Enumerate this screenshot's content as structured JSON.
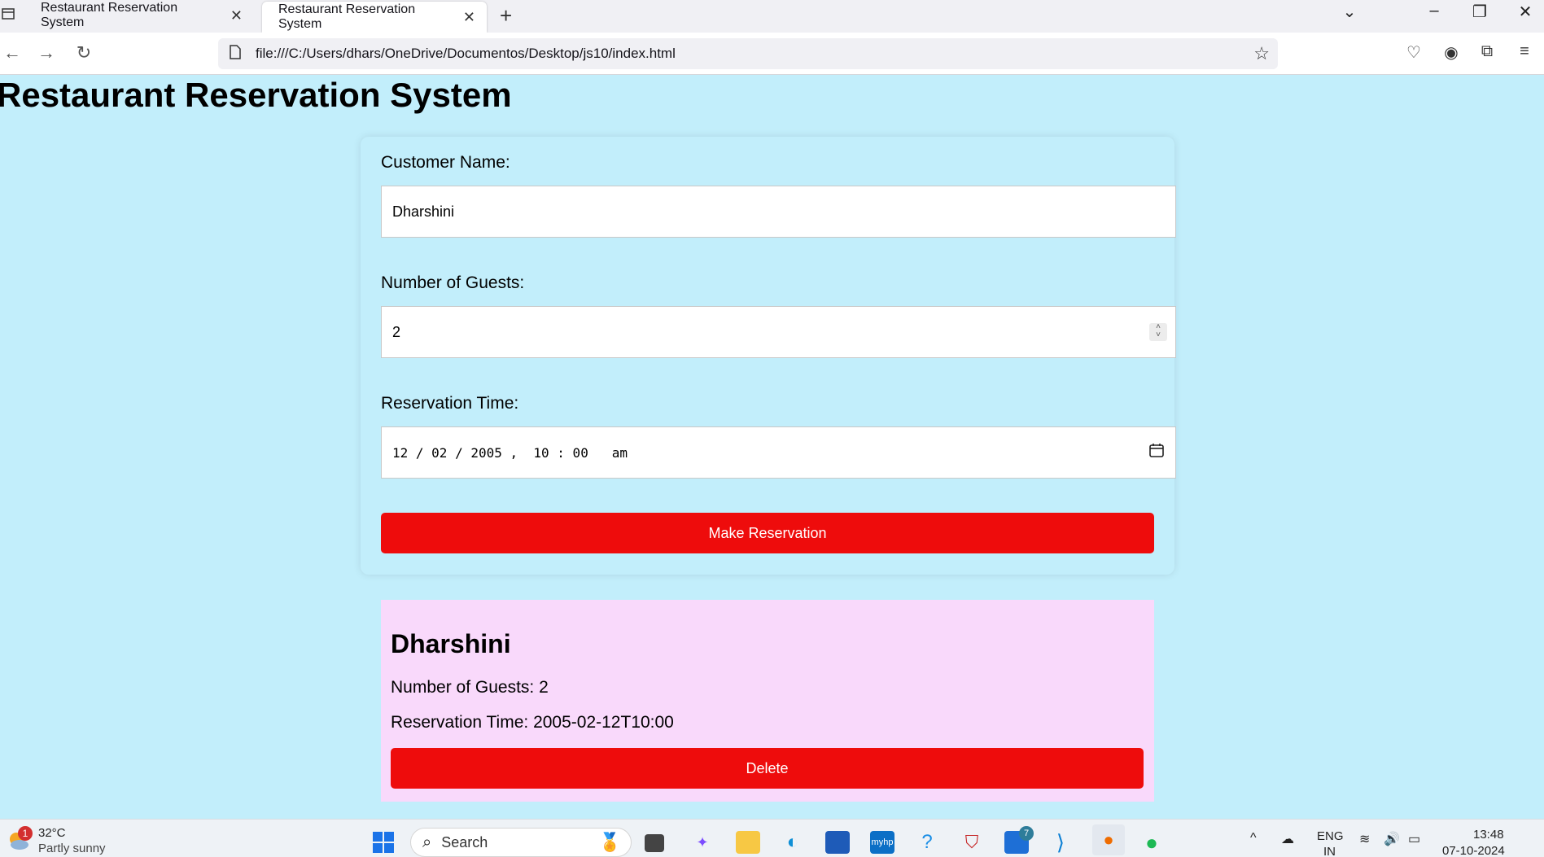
{
  "browser": {
    "tabs": [
      {
        "title": "Restaurant Reservation System",
        "active": false
      },
      {
        "title": "Restaurant Reservation System",
        "active": true
      }
    ],
    "url": "file:///C:/Users/dhars/OneDrive/Documentos/Desktop/js10/index.html"
  },
  "page": {
    "heading": "Restaurant Reservation System",
    "form": {
      "name_label": "Customer Name:",
      "name_value": "Dharshini",
      "guests_label": "Number of Guests:",
      "guests_value": "2",
      "time_label": "Reservation Time:",
      "time_value": "12 / 02 / 2005 ,  10 : 00   am",
      "submit_label": "Make Reservation"
    },
    "reservation": {
      "name": "Dharshini",
      "guests_line": "Number of Guests: 2",
      "time_line": "Reservation Time: 2005-02-12T10:00",
      "delete_label": "Delete"
    },
    "colors": {
      "background": "#c2eefb",
      "button": "#ee0c0c",
      "reservation_card": "#f9d9fb"
    }
  },
  "taskbar": {
    "weather_badge": "1",
    "temperature": "32°C",
    "condition": "Partly sunny",
    "search_placeholder": "Search",
    "store_badge": "7",
    "lang_line1": "ENG",
    "lang_line2": "IN",
    "time": "13:48",
    "date": "07-10-2024"
  }
}
